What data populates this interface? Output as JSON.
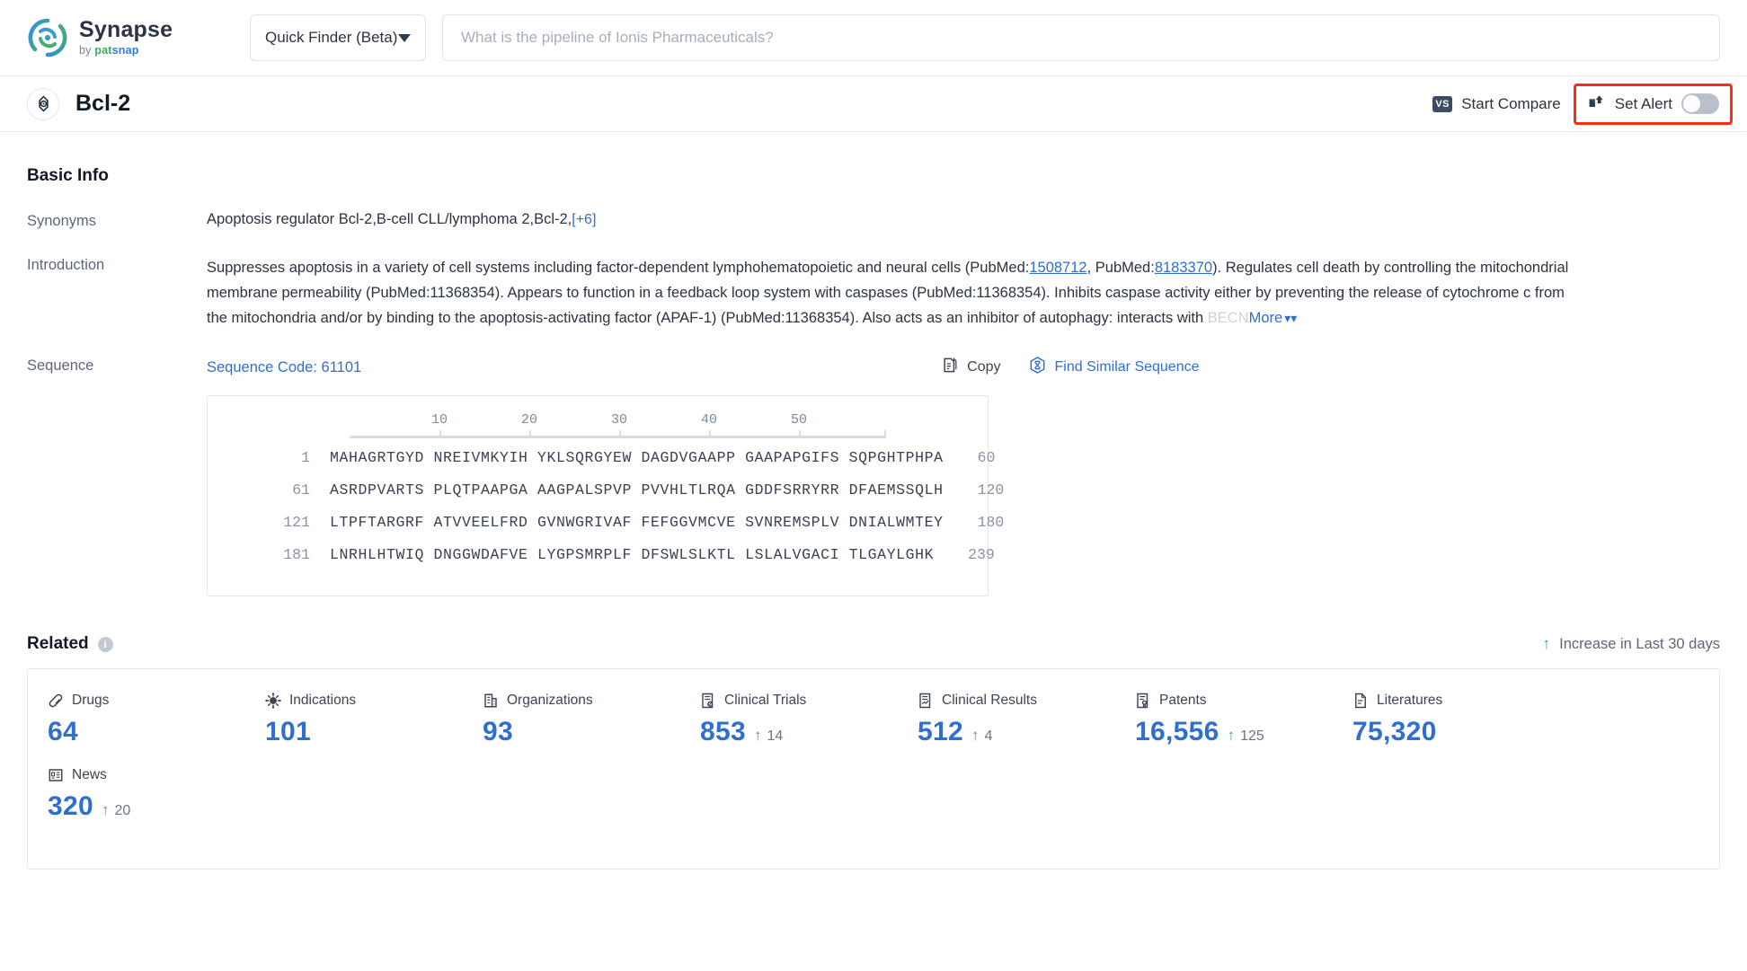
{
  "brand": {
    "name": "Synapse",
    "tagline_prefix": "by ",
    "tagline_pat": "pat",
    "tagline_snap": "snap",
    "logo_icon": "synapse-swirl-logo"
  },
  "topbar": {
    "finder_label": "Quick Finder (Beta)",
    "finder_caret_icon": "chevron-down-icon",
    "search_value": "",
    "search_placeholder": "What is the pipeline of Ionis Pharmaceuticals?"
  },
  "entity": {
    "icon": "target-icon",
    "name": "Bcl-2",
    "compare_label": "Start Compare",
    "compare_icon": "vs-badge-icon",
    "alert_label": "Set Alert",
    "alert_icon": "alert-upload-icon",
    "alert_enabled": false,
    "highlight_color": "#ff2b17"
  },
  "basic_info": {
    "title": "Basic Info",
    "synonyms": {
      "label": "Synonyms",
      "value": "Apoptosis regulator Bcl-2,B-cell CLL/lymphoma 2,Bcl-2,",
      "more_count": "[+6]"
    },
    "introduction": {
      "label": "Introduction",
      "part1": "Suppresses apoptosis in a variety of cell systems including factor-dependent lymphohematopoietic and neural cells (PubMed:",
      "pubmed1": "1508712",
      "part2": ", PubMed:",
      "pubmed2": "8183370",
      "part3": "). Regulates cell death by controlling the mitochondrial membrane permeability (PubMed:11368354). Appears to function in a feedback loop system with caspases (PubMed:11368354). Inhibits caspase activity either by preventing the release of cytochrome c from the mitochondria and/or by binding to the apoptosis-activating factor (APAF-1) (PubMed:11368354). Also acts as an inhibitor of autophagy: interacts with ",
      "fade_tail": "BECN",
      "more_label": "More",
      "more_icon": "chevron-double-down-icon"
    },
    "sequence": {
      "label": "Sequence",
      "code_label": "Sequence Code: 61101",
      "copy_label": "Copy",
      "copy_icon": "copy-icon",
      "similar_label": "Find Similar Sequence",
      "similar_icon": "dna-hexagon-icon",
      "ruler_ticks": [
        "10",
        "20",
        "30",
        "40",
        "50"
      ],
      "rows": [
        {
          "start": "1",
          "chunks": "MAHAGRTGYD NREIVMKYIH YKLSQRGYEW DAGDVGAAPP GAAPAPGIFS SQPGHTPHPA",
          "end": "60"
        },
        {
          "start": "61",
          "chunks": "ASRDPVARTS PLQTPAAPGA AAGPALSPVP PVVHLTLRQA GDDFSRRYRR DFAEMSSQLH",
          "end": "120"
        },
        {
          "start": "121",
          "chunks": "LTPFTARGRF ATVVEELFRD GVNWGRIVAF FEFGGVMCVE SVNREMSPLV DNIALWMTEY",
          "end": "180"
        },
        {
          "start": "181",
          "chunks": "LNRHLHTWIQ DNGGWDAFVE LYGPSMRPLF DFSWLSLKTL LSLALVGACI TLGAYLGHK",
          "end": "239"
        }
      ]
    }
  },
  "related": {
    "title": "Related",
    "info_icon": "info-icon",
    "legend_label": "Increase in Last 30 days",
    "legend_arrow_icon": "arrow-up-icon",
    "stats": [
      {
        "label": "Drugs",
        "icon": "pill-icon",
        "value": "64",
        "delta": ""
      },
      {
        "label": "Indications",
        "icon": "virus-icon",
        "value": "101",
        "delta": ""
      },
      {
        "label": "Organizations",
        "icon": "building-icon",
        "value": "93",
        "delta": ""
      },
      {
        "label": "Clinical Trials",
        "icon": "clinical-trial-icon",
        "value": "853",
        "delta": "14"
      },
      {
        "label": "Clinical Results",
        "icon": "clinical-result-icon",
        "value": "512",
        "delta": "4"
      },
      {
        "label": "Patents",
        "icon": "patent-icon",
        "value": "16,556",
        "delta": "125"
      },
      {
        "label": "Literatures",
        "icon": "literature-icon",
        "value": "75,320",
        "delta": ""
      },
      {
        "label": "News",
        "icon": "news-icon",
        "value": "320",
        "delta": "20"
      }
    ]
  },
  "colors": {
    "accent_blue": "#2f6fd0",
    "increase_green": "#46a752",
    "highlight_red": "#ff2b17"
  }
}
